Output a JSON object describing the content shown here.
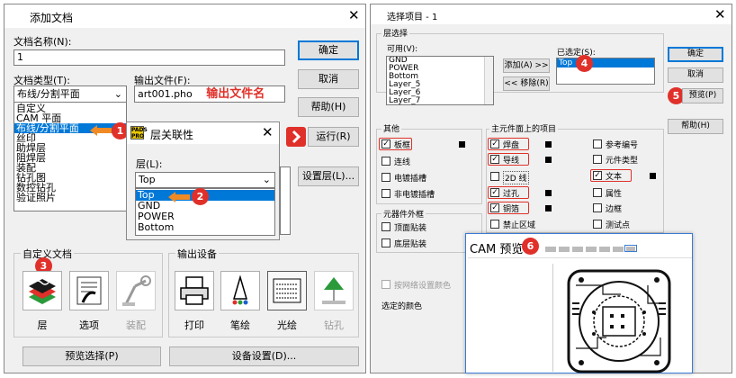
{
  "left": {
    "title": "添加文档",
    "doc_name_label": "文档名称(N):",
    "doc_name_value": "1",
    "ok": "确定",
    "doc_type_label": "文档类型(T):",
    "doc_type_value": "布线/分割平面",
    "output_file_label": "输出文件(F):",
    "output_file_value": "art001.pho",
    "output_file_note": "输出文件名",
    "cancel": "取消",
    "help": "帮助(H)",
    "run": "运行(R)",
    "setup_layer": "设置层(L)...",
    "doc_type_options": [
      "自定义",
      "CAM 平面",
      "布线/分割平面",
      "丝印",
      "助焊层",
      "阻焊层",
      "装配",
      "钻孔图",
      "数控钻孔",
      "验证照片"
    ],
    "custom_docs_label": "自定义文档",
    "output_device_label": "输出设备",
    "custom_tools": [
      "层",
      "选项",
      "装配"
    ],
    "device_tools": [
      "打印",
      "笔绘",
      "光绘",
      "钻孔"
    ],
    "preview_select": "预览选择(P)",
    "device_setup": "设备设置(D)..."
  },
  "layer_assoc": {
    "title": "层关联性",
    "layer_label": "层(L):",
    "combo_value": "Top",
    "options": [
      "Top",
      "GND",
      "POWER",
      "Bottom"
    ]
  },
  "right": {
    "title": "选择项目 - 1",
    "layer_select_label": "层选择",
    "available_label": "可用(V):",
    "available": [
      "GND",
      "POWER",
      "Bottom",
      "Layer_5",
      "Layer_6",
      "Layer_7"
    ],
    "selected_label": "已选定(S):",
    "selected": [
      "Top"
    ],
    "add_btn": "添加(A) >>",
    "remove_btn": "<< 移除(R)",
    "ok": "确定",
    "cancel": "取消",
    "preview": "预览(P)",
    "help": "帮助(H)",
    "other_label": "其他",
    "other_items": [
      "板框",
      "连线",
      "电镀插槽",
      "非电镀插槽"
    ],
    "main_elements_label": "主元件面上的项目",
    "main_col1": [
      "焊盘",
      "导线",
      "2D 线",
      "过孔",
      "铜箔",
      "禁止区域"
    ],
    "main_col2": [
      "参考编号",
      "元件类型",
      "文本",
      "属性",
      "边框",
      "测试点"
    ],
    "outline_label": "元器件外框",
    "outline_items": [
      "顶面贴装",
      "底层贴装"
    ],
    "by_net_color": "按网络设置颜色",
    "selected_color": "选定的颜色",
    "cam_preview_title": "CAM 预览"
  },
  "badges": [
    "1",
    "2",
    "3",
    "4",
    "5",
    "6"
  ]
}
